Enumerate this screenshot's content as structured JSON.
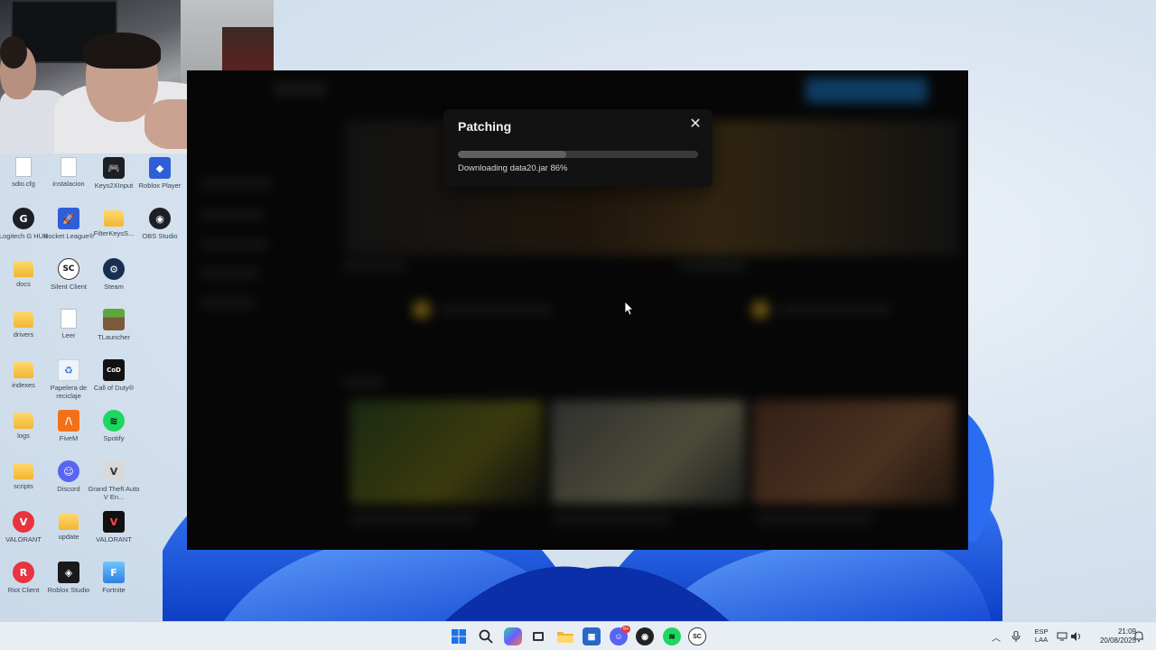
{
  "desktop": {
    "icons": [
      {
        "label": "sdio.cfg",
        "icon": "file-icon"
      },
      {
        "label": "instalacion",
        "icon": "file-icon"
      },
      {
        "label": "Keys2XInput",
        "icon": "gamepad-icon"
      },
      {
        "label": "Roblox Player",
        "icon": "roblox-player-icon"
      },
      {
        "label": "Logitech G HUB",
        "icon": "logitech-ghub-icon"
      },
      {
        "label": "Rocket League®",
        "icon": "rocket-league-icon"
      },
      {
        "label": "FilterKeysS...",
        "icon": "folder-icon"
      },
      {
        "label": "OBS Studio",
        "icon": "obs-icon"
      },
      {
        "label": "docs",
        "icon": "folder-icon"
      },
      {
        "label": "Silent Client",
        "icon": "silent-client-icon"
      },
      {
        "label": "Steam",
        "icon": "steam-icon"
      },
      {
        "label": "drivers",
        "icon": "folder-icon"
      },
      {
        "label": "Leer",
        "icon": "file-icon"
      },
      {
        "label": "TLauncher",
        "icon": "minecraft-icon"
      },
      {
        "label": "indexes",
        "icon": "folder-icon"
      },
      {
        "label": "Papelera de reciclaje",
        "icon": "recycle-bin-icon"
      },
      {
        "label": "Call of Duty®",
        "icon": "call-of-duty-icon"
      },
      {
        "label": "logs",
        "icon": "folder-icon"
      },
      {
        "label": "FiveM",
        "icon": "fivem-icon"
      },
      {
        "label": "Spotify",
        "icon": "spotify-icon"
      },
      {
        "label": "scripts",
        "icon": "folder-icon"
      },
      {
        "label": "Discord",
        "icon": "discord-icon"
      },
      {
        "label": "Grand Theft Auto V En...",
        "icon": "gta-icon"
      },
      {
        "label": "VALORANT",
        "icon": "valorant-icon"
      },
      {
        "label": "update",
        "icon": "folder-icon"
      },
      {
        "label": "VALORANT",
        "icon": "valorant-icon"
      },
      {
        "label": "Riot Client",
        "icon": "riot-client-icon"
      },
      {
        "label": "Roblox Studio",
        "icon": "roblox-studio-icon"
      },
      {
        "label": "Fortnite",
        "icon": "fortnite-icon"
      }
    ]
  },
  "dialog": {
    "title": "Patching",
    "close_glyph": "✕",
    "progress": 0.45,
    "status": "Downloading data20.jar 86%"
  },
  "taskbar": {
    "apps": [
      "windows-start-icon",
      "search-icon",
      "copilot-icon",
      "task-view-icon",
      "file-explorer-icon",
      "store-icon",
      "discord-icon",
      "obs-icon",
      "spotify-icon",
      "silent-client-icon"
    ],
    "discord_badge": "9+",
    "language": "ESP",
    "layout": "LAA",
    "time": "21:09",
    "date": "20/08/2025"
  },
  "colors": {
    "launcher_bg": "#0c0c0c",
    "dialog_bg": "#121212",
    "taskbar_bg": "#e9eef4",
    "wallpaper_blue": "#1f5fe0"
  }
}
